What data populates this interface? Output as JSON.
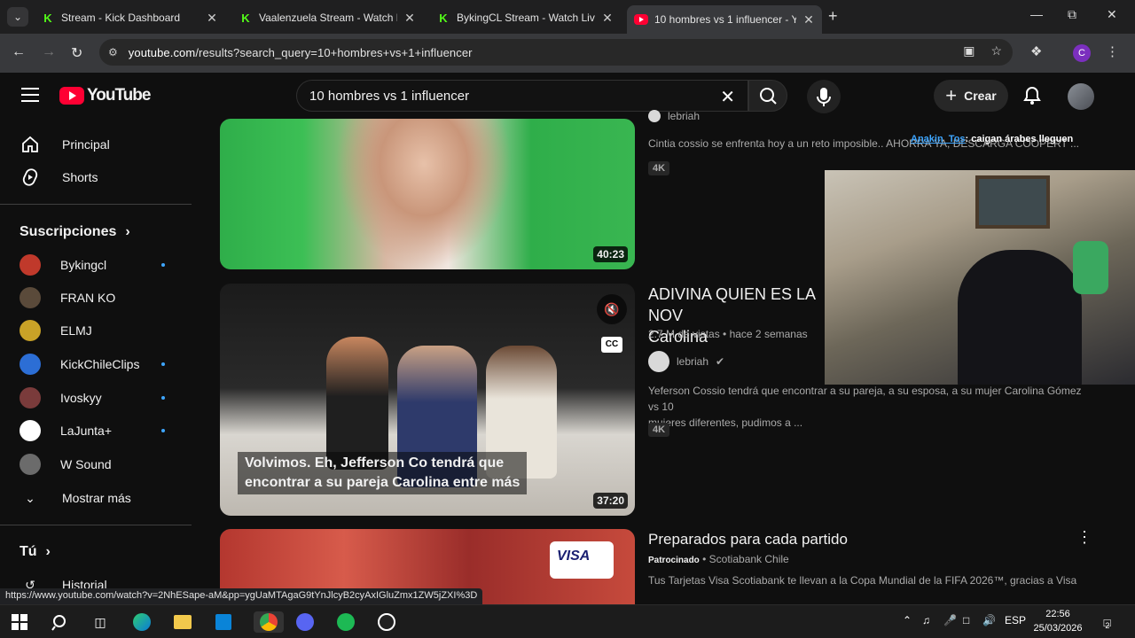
{
  "browser": {
    "tabs": [
      {
        "title": "Stream - Kick Dashboard",
        "icon": "kick-icon",
        "active": false
      },
      {
        "title": "Vaalenzuela Stream - Watch Liv",
        "icon": "kick-icon",
        "active": false
      },
      {
        "title": "BykingCL Stream - Watch Live o",
        "icon": "kick-icon",
        "active": false
      },
      {
        "title": "10 hombres vs 1 influencer - Yo",
        "icon": "youtube-icon",
        "active": true
      }
    ],
    "url_host": "youtube.com",
    "url_path": "/results?search_query=10+hombres+vs+1+influencer",
    "profile_initial": "C"
  },
  "youtube": {
    "logo_text": "YouTube",
    "search_query": "10 hombres vs 1 influencer",
    "create_label": "Crear"
  },
  "sidebar": {
    "main": [
      {
        "label": "Principal",
        "icon": "home-icon"
      },
      {
        "label": "Shorts",
        "icon": "shorts-icon"
      }
    ],
    "subscriptions_title": "Suscripciones",
    "subscriptions": [
      {
        "label": "Bykingcl",
        "color": "#c0392b",
        "live": true
      },
      {
        "label": "FRAN KO",
        "color": "#5a4a3a",
        "live": false
      },
      {
        "label": "ELMJ",
        "color": "#c9a227",
        "live": false
      },
      {
        "label": "KickChileClips",
        "color": "#2c6ed5",
        "live": true
      },
      {
        "label": "Ivoskyy",
        "color": "#7a3b3b",
        "live": true
      },
      {
        "label": "LaJunta+",
        "color": "#ffffff",
        "live": true
      },
      {
        "label": "W Sound",
        "color": "#6b6b6b",
        "live": false
      }
    ],
    "show_more": "Mostrar más",
    "you_label": "Tú",
    "history_label": "Historial"
  },
  "results": [
    {
      "description": "Cintia cossio se enfrenta hoy a un reto imposible.. AHORRA YA, DESCARGA COOPERT ...",
      "channel": "lebriah",
      "badge": "4K",
      "duration": "40:23"
    },
    {
      "title_line1": "ADIVINA QUIEN ES LA NOV",
      "title_line2": "Carolina",
      "views": "2.7 M de vistas",
      "age": "hace 2 semanas",
      "channel": "lebriah",
      "description_line1": "Yeferson Cossio tendrá que encontrar a su pareja, a su esposa, a su mujer Carolina Gómez vs 10",
      "description_line2": "mujeres diferentes, pudimos a ...",
      "badge": "4K",
      "duration": "37:20",
      "caption_line1": "Volvimos. Eh, Jefferson Co tendrá que",
      "caption_line2": "encontrar a su pareja Carolina entre más"
    },
    {
      "title": "Preparados para cada partido",
      "sponsored": "Patrocinado",
      "advertiser": "Scotiabank Chile",
      "description": "Tus Tarjetas Visa Scotiabank te llevan a la Copa Mundial de la FIFA 2026™, gracias a Visa",
      "visa_text": "VISA"
    }
  ],
  "chat_overlay": {
    "name": "Anakin_Tos",
    "message": ": caigan árabes lleguen"
  },
  "status_url": "https://www.youtube.com/watch?v=2NhESape-aM&pp=ygUaMTAgaG9tYnJlcyB2cyAxIGluZmx1ZW5jZXI%3D",
  "taskbar": {
    "language": "ESP",
    "time": "22:56",
    "date": "25/03/2026",
    "notification_count": "2"
  }
}
